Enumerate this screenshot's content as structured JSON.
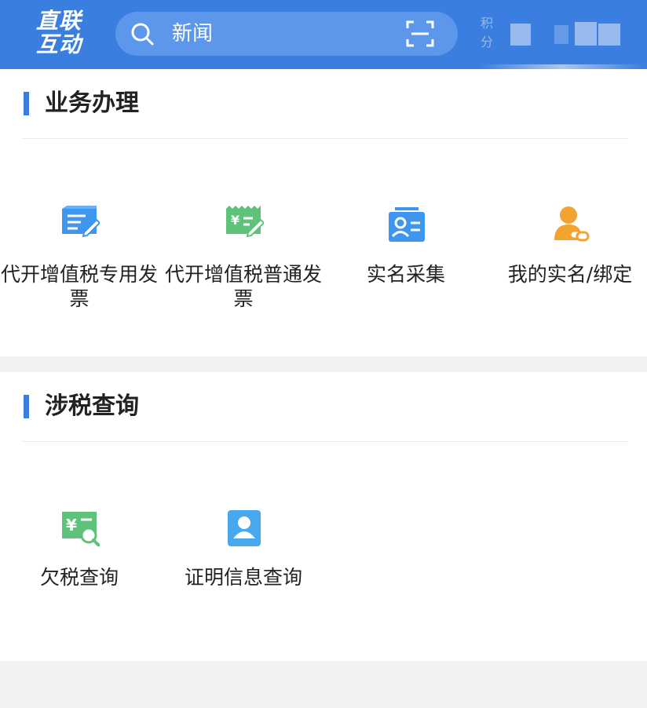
{
  "header": {
    "logo_line1": "直联",
    "logo_line2": "互动",
    "search_text": "新闻",
    "points_label": "积分"
  },
  "sections": [
    {
      "title": "业务办理",
      "items": [
        {
          "label": "代开增值税专用发票",
          "icon": "special-invoice-icon"
        },
        {
          "label": "代开增值税普通发票",
          "icon": "general-invoice-icon"
        },
        {
          "label": "实名采集",
          "icon": "id-card-icon"
        },
        {
          "label": "我的实名/绑定",
          "icon": "user-link-icon"
        }
      ]
    },
    {
      "title": "涉税查询",
      "items": [
        {
          "label": "欠税查询",
          "icon": "tax-arrears-search-icon"
        },
        {
          "label": "证明信息查询",
          "icon": "certificate-query-icon"
        }
      ]
    }
  ],
  "colors": {
    "header_bg": "#3a7ee0",
    "accent": "#3a7ee0",
    "icon_blue": "#3e96ef",
    "icon_green": "#5fc27a",
    "icon_orange": "#f3a32f"
  }
}
